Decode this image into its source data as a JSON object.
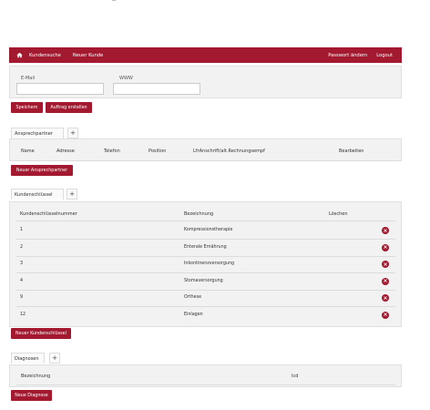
{
  "nav": {
    "home_icon": "home-icon",
    "links": [
      "Kundensuche",
      "Neuer Kunde"
    ],
    "password": "Passwort ändern",
    "logout": "Logout"
  },
  "web": {
    "email_label": "E-Mail",
    "www_label": "WWW",
    "email_value": "",
    "www_value": ""
  },
  "actions": {
    "save": "Speichern",
    "create_order": "Auftrag erstellen"
  },
  "contacts": {
    "tab": "Ansprechpartner",
    "plus": "+",
    "headers": [
      "Name",
      "Adresse",
      "Telefon",
      "Position",
      "LfrAnschrift/alt.Rechnungsempf",
      "Bearbeiten"
    ],
    "new_button": "Neuer Ansprechpartner"
  },
  "keys": {
    "tab": "Kundenschlüssel",
    "plus": "+",
    "headers": [
      "Kundenschlüsselnummer",
      "Bezeichnung",
      "Löschen"
    ],
    "rows": [
      {
        "num": "1",
        "label": "Kompressionstherapie"
      },
      {
        "num": "2",
        "label": "Enterale Ernährung"
      },
      {
        "num": "3",
        "label": "Inkontinenzversorgung"
      },
      {
        "num": "4",
        "label": "Stomaversorgung"
      },
      {
        "num": "9",
        "label": "Orthese"
      },
      {
        "num": "12",
        "label": "Einlagen"
      }
    ],
    "delete_icon": "delete-icon",
    "new_button": "Neuer Kundenschlüssel"
  },
  "diagnoses": {
    "tab": "Diagnosen",
    "plus": "+",
    "headers": [
      "Bezeichnung",
      "Icd"
    ],
    "new_button": "Neue Diagnose"
  },
  "colors": {
    "accent": "#a3192f",
    "panel": "#f2f2f2"
  }
}
